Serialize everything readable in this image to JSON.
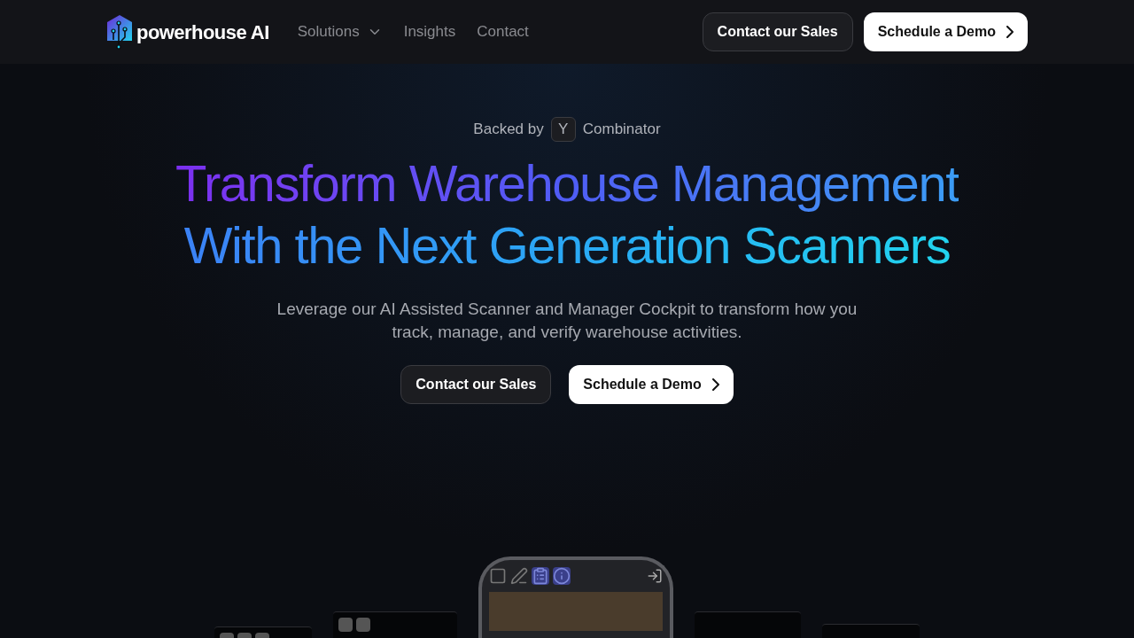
{
  "brand": {
    "name": "powerhouse AI"
  },
  "nav": [
    {
      "label": "Solutions",
      "kind": "dropdown"
    },
    {
      "label": "Insights",
      "kind": "link"
    },
    {
      "label": "Contact",
      "kind": "link"
    }
  ],
  "header_buttons": [
    {
      "label": "Contact our Sales",
      "kind": "secondary"
    },
    {
      "label": "Schedule a Demo",
      "kind": "primary"
    }
  ],
  "hero": {
    "backed_prefix": "Backed by",
    "backed_badge": "Y",
    "backed_suffix": "Combinator",
    "title_lines": [
      "Transform Warehouse Management",
      "With the Next Generation Scanners"
    ],
    "subtitle": "Leverage our AI Assisted Scanner and Manager Cockpit to transform how you track, manage, and verify warehouse activities.",
    "buttons": [
      {
        "label": "Contact our Sales",
        "kind": "secondary"
      },
      {
        "label": "Schedule a Demo",
        "kind": "primary"
      }
    ]
  }
}
